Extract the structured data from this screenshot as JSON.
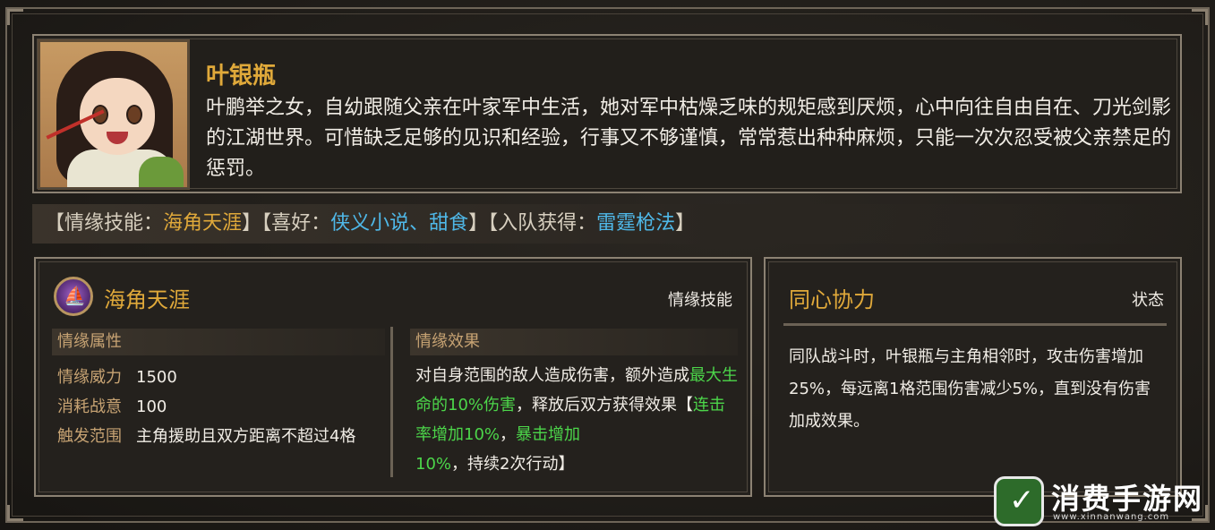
{
  "character": {
    "name": "叶银瓶",
    "description": "叶鹏举之女，自幼跟随父亲在叶家军中生活，她对军中枯燥乏味的规矩感到厌烦，心中向往自由自在、刀光剑影的江湖世界。可惜缺乏足够的见识和经验，行事又不够谨慎，常常惹出种种麻烦，只能一次次忍受被父亲禁足的惩罚。"
  },
  "tags": {
    "bond_skill_label": "情缘技能：",
    "bond_skill_value": "海角天涯",
    "hobby_label": "喜好：",
    "hobby_value": "侠义小说、甜食",
    "join_reward_label": "入队获得：",
    "join_reward_value": "雷霆枪法",
    "open_bracket": "【",
    "close_bracket": "】"
  },
  "skill": {
    "name": "海角天涯",
    "type": "情缘技能",
    "attributes_header": "情缘属性",
    "attributes": [
      {
        "key": "情缘威力",
        "value": "1500"
      },
      {
        "key": "消耗战意",
        "value": "100"
      },
      {
        "key": "触发范围",
        "value": "主角援助且双方距离不超过4格"
      }
    ],
    "effects_header": "情缘效果",
    "effect_parts": {
      "p1": "对自身范围的敌人造成伤害，额外造成",
      "g1": "最大生命的10%伤害",
      "p2": "，释放后双方获得效果【",
      "g2": "连击率增加10%",
      "p3": "，",
      "g3": "暴击增加10%",
      "p4": "，持续2次行动】"
    }
  },
  "status": {
    "name": "同心协力",
    "type": "状态",
    "description": "同队战斗时，叶银瓶与主角相邻时，攻击伤害增加25%，每远离1格范围伤害减少5%，直到没有伤害加成效果。"
  },
  "watermark": {
    "title": "消费手游网",
    "url": "www.xinnanwang.com"
  },
  "colors": {
    "gold": "#e0a93a",
    "blue": "#4fb8e8",
    "green": "#4cd64a"
  }
}
